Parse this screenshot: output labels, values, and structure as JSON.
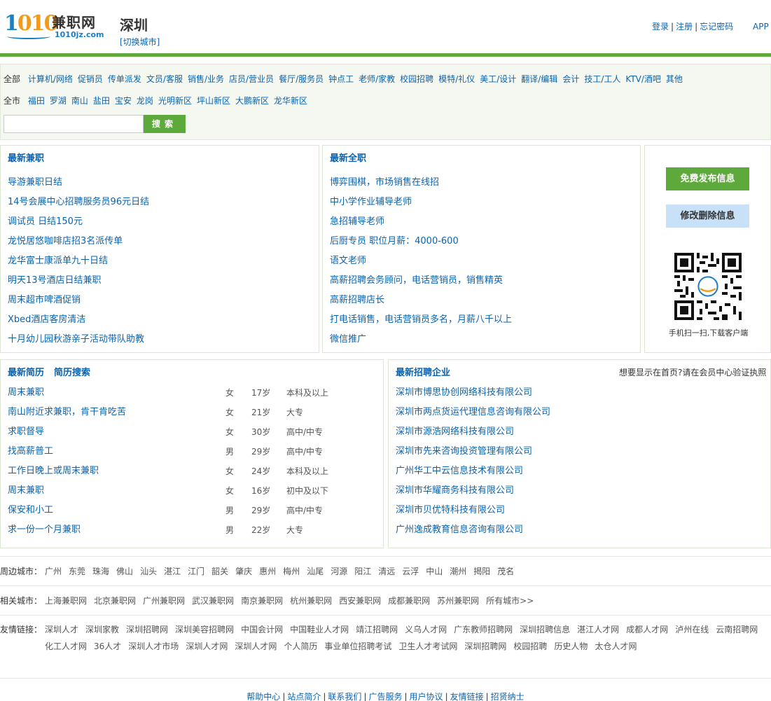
{
  "header": {
    "logo_number": "1010",
    "logo_name": "兼职网",
    "logo_domain": "1010jz.com",
    "city": "深圳",
    "switch_city": "[切换城市]",
    "login": "登录",
    "register": "注册",
    "forgot": "忘记密码",
    "app": "APP"
  },
  "colors": {
    "brand_green": "#5ea93c",
    "link_blue": "#0b63b0",
    "logo_orange": "#f29a1b"
  },
  "filter": {
    "categories_all": "全部",
    "categories": [
      "计算机/网络",
      "促销员",
      "传单派发",
      "文员/客服",
      "销售/业务",
      "店员/营业员",
      "餐厅/服务员",
      "钟点工",
      "老师/家教",
      "校园招聘",
      "模特/礼仪",
      "美工/设计",
      "翻译/编辑",
      "会计",
      "技工/工人",
      "KTV/酒吧",
      "其他"
    ],
    "districts_all": "全市",
    "districts": [
      "福田",
      "罗湖",
      "南山",
      "盐田",
      "宝安",
      "龙岗",
      "光明新区",
      "坪山新区",
      "大鹏新区",
      "龙华新区"
    ],
    "search_placeholder": "",
    "search_button": "搜索"
  },
  "latest_parttime": {
    "title": "最新兼职",
    "items": [
      "导游兼职日结",
      "14号会展中心招聘服务员96元日结",
      "调试员 日结150元",
      "龙悦居悠咖啡店招3名派传单",
      "龙华富士康派单九十日结",
      "明天13号酒店日结兼职",
      "周末超市啤酒促销",
      "Xbed酒店客房清洁",
      "十月幼儿园秋游亲子活动带队助教"
    ]
  },
  "latest_fulltime": {
    "title": "最新全职",
    "items": [
      "博弈围棋，市场销售在线招",
      "中小学作业辅导老师",
      "急招辅导老师",
      "后厨专员 职位月薪：4000-600",
      "语文老师",
      "高薪招聘会务顾问，电话营销员，销售精英",
      "高薪招聘店长",
      "打电话销售，电话营销员多名，月薪八千以上",
      "微信推广"
    ]
  },
  "sidebar": {
    "publish_button": "免费发布信息",
    "edit_button": "修改删除信息",
    "qr_caption": "手机扫一扫,下载客户端",
    "qr_icon": "qr-code-icon"
  },
  "resumes": {
    "title": "最新简历",
    "search_link": "简历搜索",
    "rows": [
      {
        "title": "周末兼职",
        "gender": "女",
        "age": "17岁",
        "edu": "本科及以上"
      },
      {
        "title": "南山附近求兼职，肯干肯吃苦",
        "gender": "女",
        "age": "21岁",
        "edu": "大专"
      },
      {
        "title": "求职督导",
        "gender": "女",
        "age": "30岁",
        "edu": "高中/中专"
      },
      {
        "title": "找高薪普工",
        "gender": "男",
        "age": "29岁",
        "edu": "高中/中专"
      },
      {
        "title": "工作日晚上或周末兼职",
        "gender": "女",
        "age": "24岁",
        "edu": "本科及以上"
      },
      {
        "title": "周末兼职",
        "gender": "女",
        "age": "16岁",
        "edu": "初中及以下"
      },
      {
        "title": "保安和小工",
        "gender": "男",
        "age": "29岁",
        "edu": "高中/中专"
      },
      {
        "title": "求一份一个月兼职",
        "gender": "男",
        "age": "22岁",
        "edu": "大专"
      }
    ]
  },
  "companies": {
    "title": "最新招聘企业",
    "note": "想要显示在首页?请在会员中心验证执照",
    "items": [
      "深圳市博思协创网络科技有限公司",
      "深圳市两点货运代理信息咨询有限公司",
      "深圳市源浩网络科技有限公司",
      "深圳市先来咨询投资管理有限公司",
      "广州华工中云信息技术有限公司",
      "深圳市华耀商务科技有限公司",
      "深圳市贝优特科技有限公司",
      "广州逸成教育信息咨询有限公司"
    ]
  },
  "nearby": {
    "label": "周边城市：",
    "items": [
      "广州",
      "东莞",
      "珠海",
      "佛山",
      "汕头",
      "湛江",
      "江门",
      "韶关",
      "肇庆",
      "惠州",
      "梅州",
      "汕尾",
      "河源",
      "阳江",
      "清远",
      "云浮",
      "中山",
      "潮州",
      "揭阳",
      "茂名"
    ]
  },
  "related": {
    "label": "相关城市：",
    "items": [
      "上海兼职网",
      "北京兼职网",
      "广州兼职网",
      "武汉兼职网",
      "南京兼职网",
      "杭州兼职网",
      "西安兼职网",
      "成都兼职网",
      "苏州兼职网",
      "所有城市>>"
    ]
  },
  "friends": {
    "label": "友情链接：",
    "items": [
      "深圳人才",
      "深圳家教",
      "深圳招聘网",
      "深圳美容招聘网",
      "中国会计网",
      "中国鞋业人才网",
      "靖江招聘网",
      "义乌人才网",
      "广东教师招聘网",
      "深圳招聘信息",
      "湛江人才网",
      "成都人才网",
      "泸州在线",
      "云南招聘网",
      "化工人才网",
      "36人才",
      "深圳人才市场",
      "深圳人才网",
      "深圳人才网",
      "个人简历",
      "事业单位招聘考试",
      "卫生人才考试网",
      "深圳招聘网",
      "校园招聘",
      "历史人物",
      "太仓人才网"
    ]
  },
  "bottom": {
    "items": [
      "帮助中心",
      "站点简介",
      "联系我们",
      "广告服务",
      "用户协议",
      "友情链接",
      "招贤纳士"
    ]
  }
}
